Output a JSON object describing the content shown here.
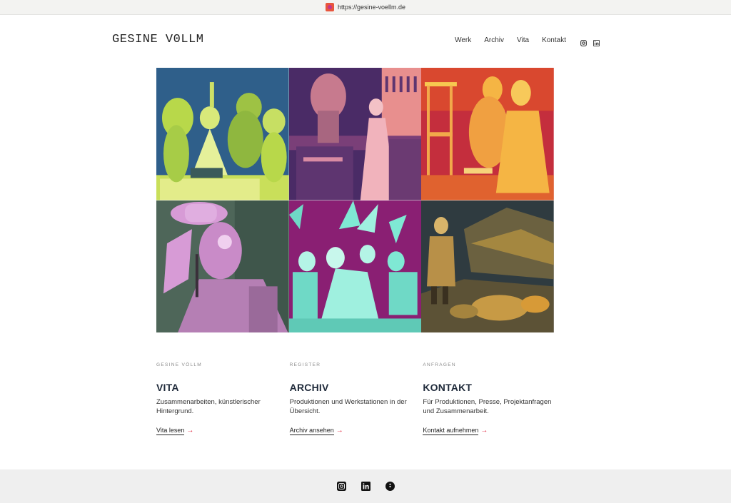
{
  "browser": {
    "url": "https://gesine-voellm.de",
    "favicon_icon": "site-favicon"
  },
  "header": {
    "logo": "GESINE V0LLM",
    "nav": [
      {
        "label": "Werk"
      },
      {
        "label": "Archiv"
      },
      {
        "label": "Vita"
      },
      {
        "label": "Kontakt"
      }
    ],
    "social_icons": [
      "instagram-icon",
      "linkedin-icon"
    ]
  },
  "gallery": {
    "tiles": [
      {
        "subject": "costumed birds scene",
        "tint": "#b8d84a",
        "shade": "#2f5f8a"
      },
      {
        "subject": "figure at bar",
        "tint": "#e88f8e",
        "shade": "#4a2b66"
      },
      {
        "subject": "two women on chair",
        "tint": "#f5b544",
        "shade": "#c42e3d"
      },
      {
        "subject": "masked figure with hat",
        "tint": "#d79bd6",
        "shade": "#4e6659"
      },
      {
        "subject": "ensemble with wings",
        "tint": "#7fe8d4",
        "shade": "#8a1f73"
      },
      {
        "subject": "woman on rocky stage",
        "tint": "#d79a37",
        "shade": "#2f3b40"
      }
    ]
  },
  "cards": [
    {
      "eyebrow": "GESINE VÖLLM",
      "title": "VITA",
      "text": "Zusammenarbeiten, künstlerischer Hintergrund.",
      "link": "Vita lesen",
      "arrow": "→"
    },
    {
      "eyebrow": "REGISTER",
      "title": "ARCHIV",
      "text": "Produktionen und Werkstationen in der Übersicht.",
      "link": "Archiv ansehen",
      "arrow": "→"
    },
    {
      "eyebrow": "ANFRAGEN",
      "title": "KONTAKT",
      "text": "Für Produktionen, Presse, Projektanfragen und Zusammenarbeit.",
      "link": "Kontakt aufnehmen",
      "arrow": "→"
    }
  ],
  "footer": {
    "icons": [
      "instagram-icon",
      "linkedin-icon",
      "info-icon"
    ]
  },
  "colors": {
    "accent_arrow": "#e0233a",
    "text_dark": "#1f2a3a",
    "footer_bg": "#efefef"
  }
}
